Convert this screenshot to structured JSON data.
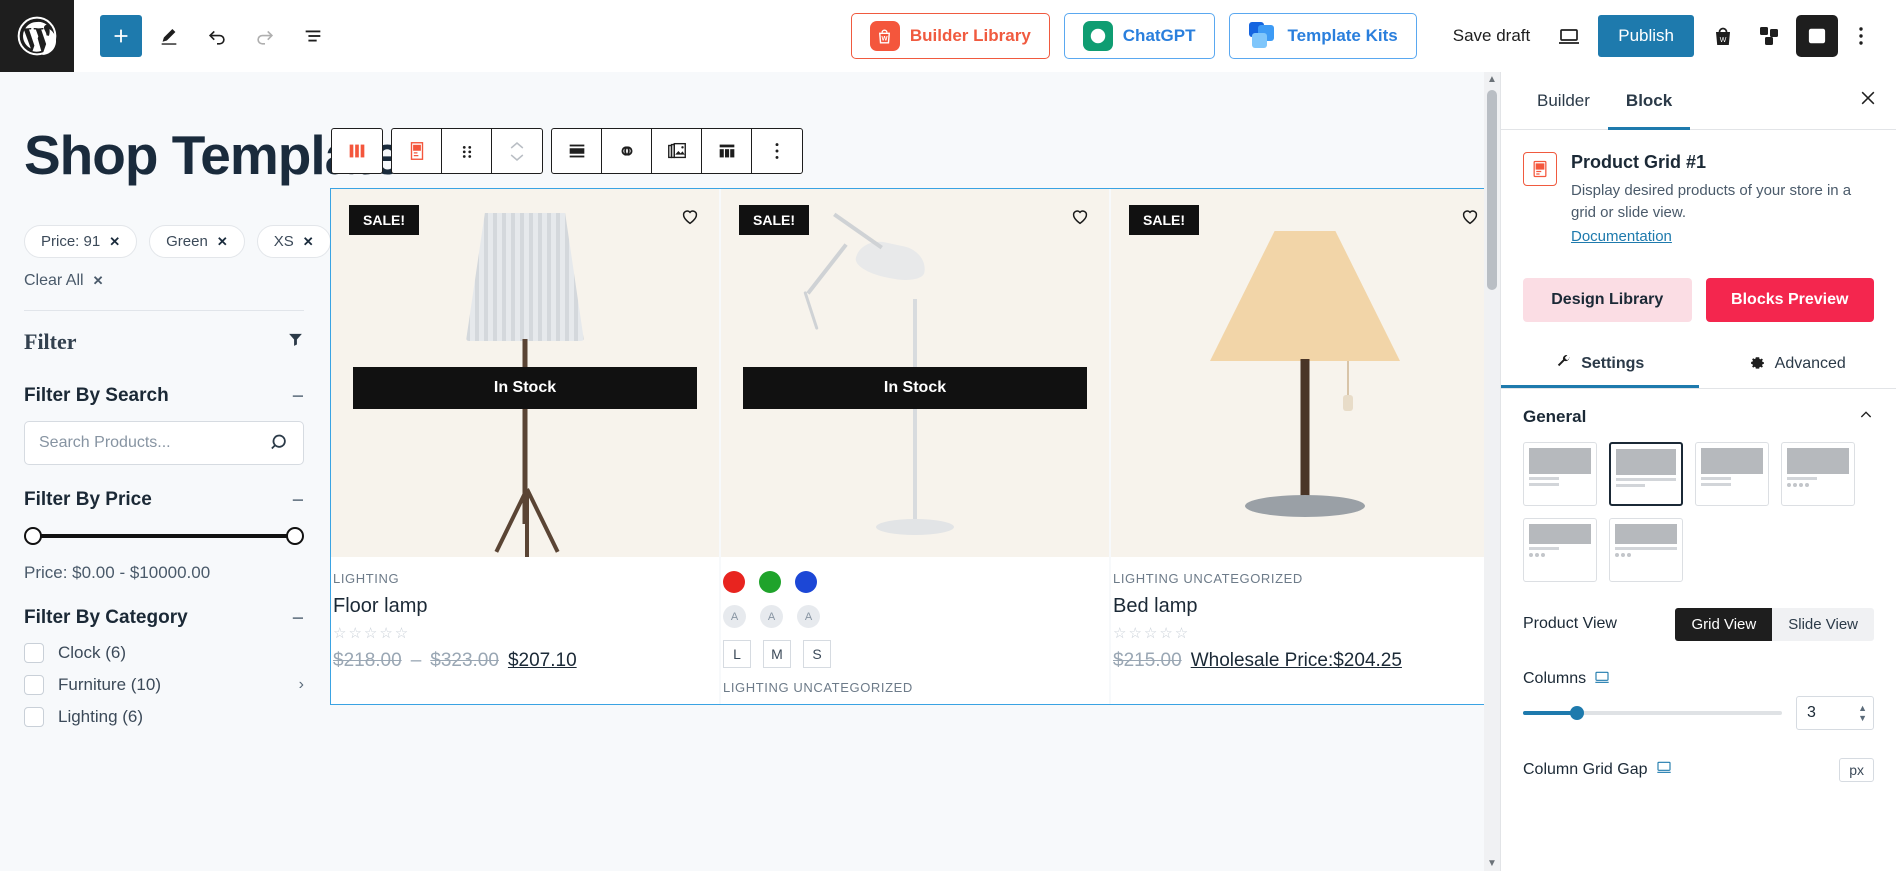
{
  "topbar": {
    "add_label": "+",
    "tools": [
      {
        "name": "edit-pencil-icon",
        "label": "Edit"
      },
      {
        "name": "undo-icon",
        "label": "Undo"
      },
      {
        "name": "redo-icon",
        "label": "Redo"
      },
      {
        "name": "list-view-icon",
        "label": "Document overview"
      }
    ],
    "builder_library": "Builder Library",
    "chatgpt": "ChatGPT",
    "template_kits": "Template Kits",
    "save_draft": "Save draft",
    "publish": "Publish",
    "preview_icon": "desktop-preview-icon",
    "shop_icon": "shop-bag-icon",
    "blocks_icon": "blocks-icon",
    "sidebar_icon": "settings-sidebar-icon",
    "more_icon": "options-menu-icon"
  },
  "canvas": {
    "page_title": "Shop Template",
    "chips": [
      {
        "label": "Price: 91"
      },
      {
        "label": "Green"
      },
      {
        "label": "XS"
      }
    ],
    "clear_all": "Clear All",
    "filter_heading": "Filter",
    "filter_search": {
      "title": "Filter By Search",
      "placeholder": "Search Products...",
      "value": ""
    },
    "filter_price": {
      "title": "Filter By Price",
      "range_text": "Price: $0.00 - $10000.00",
      "min": "$0.00",
      "max": "$10000.00"
    },
    "filter_category": {
      "title": "Filter By Category",
      "items": [
        {
          "label": "Clock (6)",
          "has_children": false
        },
        {
          "label": "Furniture (10)",
          "has_children": true
        },
        {
          "label": "Lighting (6)",
          "has_children": false
        }
      ]
    },
    "collapse_symbol": "−"
  },
  "block_toolbar": {
    "items": [
      {
        "name": "product-grid-block-icon",
        "label": "Product Grid"
      },
      {
        "name": "select-parent-block-icon",
        "label": "Select parent block"
      },
      {
        "name": "drag-handle-icon",
        "label": "Drag"
      },
      {
        "name": "move-up-down-icon",
        "label": "Move up / down"
      },
      {
        "name": "align-icon",
        "label": "Change alignment"
      },
      {
        "name": "link-icon",
        "label": "Link"
      },
      {
        "name": "media-icon",
        "label": "Replace media"
      },
      {
        "name": "layout-grid-icon",
        "label": "Layout"
      },
      {
        "name": "more-options-icon",
        "label": "Options"
      }
    ]
  },
  "products": [
    {
      "badge": "SALE!",
      "stock": "In Stock",
      "categories": "LIGHTING",
      "name": "Floor lamp",
      "rating": "☆☆☆☆☆",
      "price_old_a": "$218.00",
      "price_old_b": "$323.00",
      "price_new": "$207.10",
      "wholesale": "",
      "swatches": [],
      "sizes": []
    },
    {
      "badge": "SALE!",
      "stock": "In Stock",
      "categories": "LIGHTING  UNCATEGORIZED",
      "name": "",
      "rating": "",
      "price_old_a": "",
      "price_old_b": "",
      "price_new": "",
      "wholesale": "",
      "swatches": [
        "#e8241f",
        "#1fa32b",
        "#1c47d6"
      ],
      "swatch_letters": [
        "A",
        "A",
        "A"
      ],
      "sizes": [
        "L",
        "M",
        "S"
      ]
    },
    {
      "badge": "SALE!",
      "stock": "",
      "categories": "LIGHTING  UNCATEGORIZED",
      "name": "Bed lamp",
      "rating": "☆☆☆☆☆",
      "price_old_a": "$215.00",
      "price_old_b": "",
      "price_new": "",
      "wholesale": "Wholesale Price:$204.25",
      "swatches": [],
      "sizes": []
    }
  ],
  "right_panel": {
    "tabs": [
      {
        "label": "Builder",
        "active": false
      },
      {
        "label": "Block",
        "active": true
      }
    ],
    "block": {
      "title": "Product Grid #1",
      "description": "Display desired products of your store in a grid or slide view.",
      "documentation": "Documentation"
    },
    "buttons": {
      "design_library": "Design Library",
      "blocks_preview": "Blocks Preview"
    },
    "subtabs": [
      {
        "label": "Settings",
        "icon": "wrench-icon",
        "active": true
      },
      {
        "label": "Advanced",
        "icon": "gear-icon",
        "active": false
      }
    ],
    "general": {
      "title": "General",
      "layout_count": 6,
      "selected_layout": 2
    },
    "product_view": {
      "label": "Product View",
      "options": [
        "Grid View",
        "Slide View"
      ],
      "selected": "Grid View"
    },
    "columns": {
      "label": "Columns",
      "value": "3",
      "min": 1,
      "max": 12,
      "percent": 21
    },
    "column_grid_gap": {
      "label": "Column Grid Gap",
      "unit": "px"
    }
  }
}
